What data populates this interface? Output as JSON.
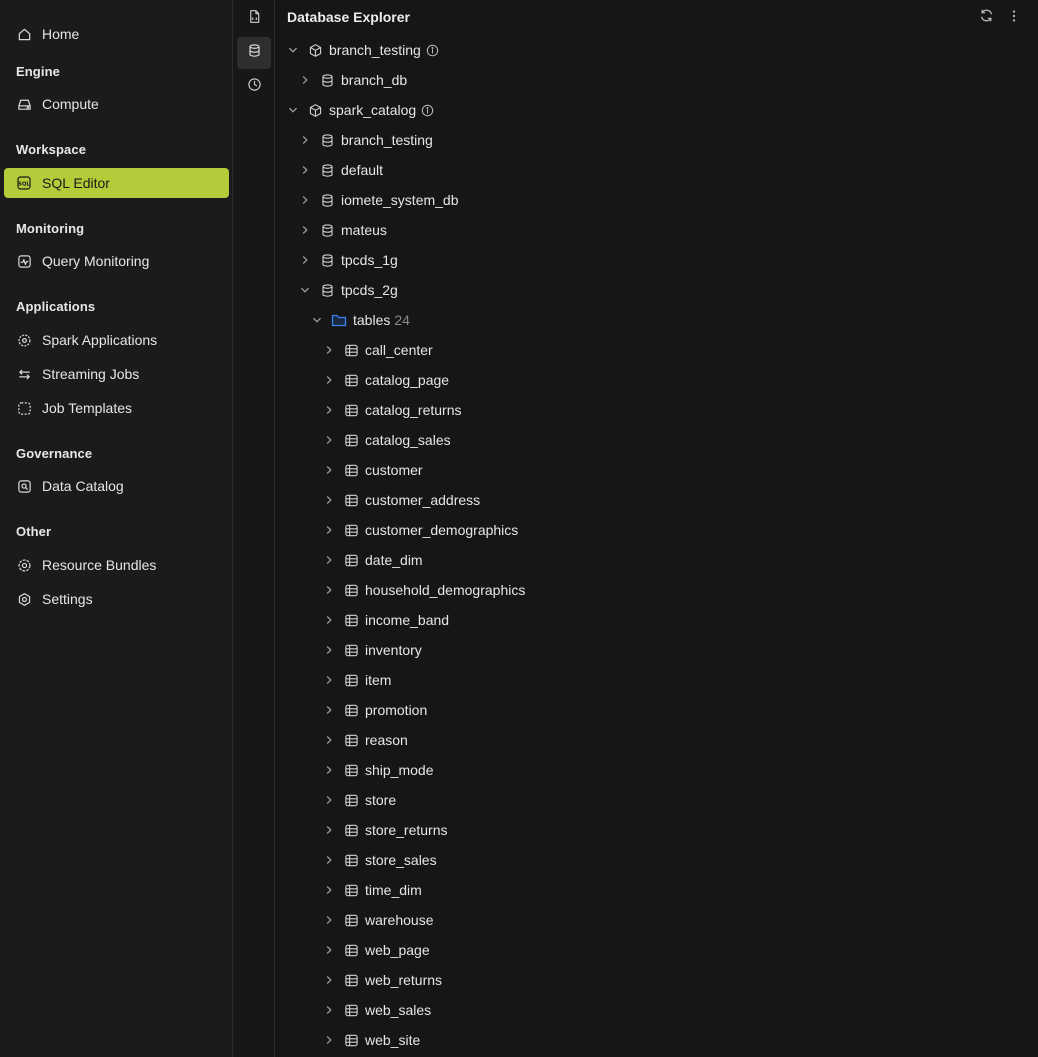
{
  "colors": {
    "accent": "#b5cc3a",
    "folder": "#3b82f6"
  },
  "nav": {
    "home": "Home",
    "sections": {
      "engine": "Engine",
      "workspace": "Workspace",
      "monitoring": "Monitoring",
      "applications": "Applications",
      "governance": "Governance",
      "other": "Other"
    },
    "items": {
      "compute": "Compute",
      "sql_editor": "SQL Editor",
      "query_monitoring": "Query Monitoring",
      "spark_applications": "Spark Applications",
      "streaming_jobs": "Streaming Jobs",
      "job_templates": "Job Templates",
      "data_catalog": "Data Catalog",
      "resource_bundles": "Resource Bundles",
      "settings": "Settings"
    },
    "active": "sql_editor"
  },
  "explorer": {
    "title": "Database Explorer",
    "catalogs": [
      {
        "name": "branch_testing",
        "expanded": true,
        "databases": [
          {
            "name": "branch_db",
            "expanded": false
          }
        ]
      },
      {
        "name": "spark_catalog",
        "expanded": true,
        "databases": [
          {
            "name": "branch_testing",
            "expanded": false
          },
          {
            "name": "default",
            "expanded": false
          },
          {
            "name": "iomete_system_db",
            "expanded": false
          },
          {
            "name": "mateus",
            "expanded": false
          },
          {
            "name": "tpcds_1g",
            "expanded": false
          },
          {
            "name": "tpcds_2g",
            "expanded": true
          }
        ]
      }
    ],
    "folder": {
      "label": "tables",
      "count": "24"
    },
    "tables": [
      "call_center",
      "catalog_page",
      "catalog_returns",
      "catalog_sales",
      "customer",
      "customer_address",
      "customer_demographics",
      "date_dim",
      "household_demographics",
      "income_band",
      "inventory",
      "item",
      "promotion",
      "reason",
      "ship_mode",
      "store",
      "store_returns",
      "store_sales",
      "time_dim",
      "warehouse",
      "web_page",
      "web_returns",
      "web_sales",
      "web_site"
    ]
  }
}
